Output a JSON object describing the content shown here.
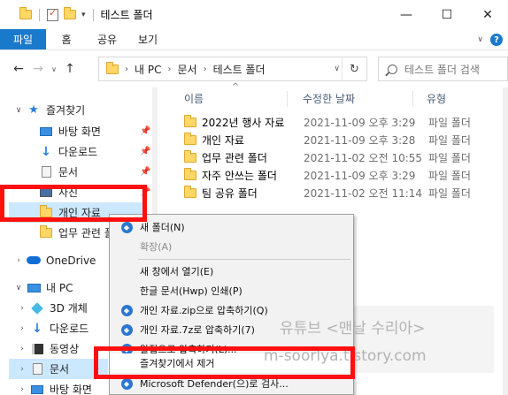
{
  "window": {
    "title": "테스트 폴더",
    "controls": {
      "minimize": "—",
      "maximize": "☐",
      "close": "✕"
    }
  },
  "ribbon": {
    "file_tab": "파일",
    "tabs": [
      "홈",
      "공유",
      "보기"
    ],
    "help_icon": "?",
    "collapse_icon": "∨"
  },
  "address": {
    "back": "←",
    "forward": "→",
    "recent": "∨",
    "up": "↑",
    "crumbs": [
      "내 PC",
      "문서",
      "테스트 폴더"
    ],
    "separator": "›",
    "dropdown": "∨",
    "refresh": "↻"
  },
  "search": {
    "placeholder": "테스트 폴더 검색"
  },
  "nav": {
    "quick_access": "즐겨찾기",
    "items": [
      {
        "label": "바탕 화면",
        "icon": "desktop-icon",
        "pinned": true
      },
      {
        "label": "다운로드",
        "icon": "download-icon",
        "pinned": true
      },
      {
        "label": "문서",
        "icon": "document-icon",
        "pinned": true
      },
      {
        "label": "사진",
        "icon": "picture-icon",
        "pinned": true
      },
      {
        "label": "개인 자료",
        "icon": "folder-icon",
        "pinned": false
      },
      {
        "label": "업무 관련 폴",
        "icon": "folder-icon",
        "pinned": false
      }
    ],
    "onedrive": "OneDrive",
    "this_pc": "내 PC",
    "pc_items": [
      {
        "label": "3D 개체",
        "icon": "3d-objects-icon"
      },
      {
        "label": "다운로드",
        "icon": "download-icon"
      },
      {
        "label": "동영상",
        "icon": "video-icon"
      },
      {
        "label": "문서",
        "icon": "document-icon"
      },
      {
        "label": "바탕 화면",
        "icon": "desktop-icon"
      }
    ]
  },
  "columns": {
    "name": "이름",
    "date": "수정한 날짜",
    "type": "유형",
    "sort_indicator": "^"
  },
  "files": [
    {
      "name": "2022년 행사 자료",
      "date": "2021-11-09 오후 3:29",
      "type": "파일 폴더"
    },
    {
      "name": "개인 자료",
      "date": "2021-11-09 오후 3:28",
      "type": "파일 폴더"
    },
    {
      "name": "업무 관련 폴더",
      "date": "2021-11-02 오전 10:55",
      "type": "파일 폴더"
    },
    {
      "name": "자주 안쓰는 폴더",
      "date": "2021-11-09 오후 3:29",
      "type": "파일 폴더"
    },
    {
      "name": "팀 공유 폴더",
      "date": "2021-11-02 오전 11:14",
      "type": "파일 폴더"
    }
  ],
  "context_menu": {
    "items": [
      {
        "label": "새 폴더(N)",
        "icon": true,
        "disabled": false
      },
      {
        "label": "확장(A)",
        "icon": false,
        "disabled": true
      },
      {
        "label": "새 창에서 열기(E)",
        "icon": false,
        "disabled": false
      },
      {
        "label": "한글 문서(Hwp) 인쇄(P)",
        "icon": false,
        "disabled": false
      },
      {
        "label": "개인 자료.zip으로 압축하기(Q)",
        "icon": true,
        "disabled": false
      },
      {
        "label": "개인 자료.7z로 압축하기(7)",
        "icon": true,
        "disabled": false
      },
      {
        "label": "알집으로 압축하기(L)...",
        "icon": true,
        "disabled": false
      },
      {
        "label": "즐겨찾기에서 제거",
        "icon": false,
        "disabled": false
      },
      {
        "label": "Microsoft Defender(으)로 검사...",
        "icon": true,
        "disabled": false
      }
    ]
  },
  "watermark": {
    "line1": "유튜브 <맨날 수리아>",
    "line2": "m-soorlya.tistory.com"
  },
  "colors": {
    "accent": "#1979ca",
    "highlight": "#ff1010",
    "selection": "#cce8ff",
    "folder": "#ffd766"
  }
}
